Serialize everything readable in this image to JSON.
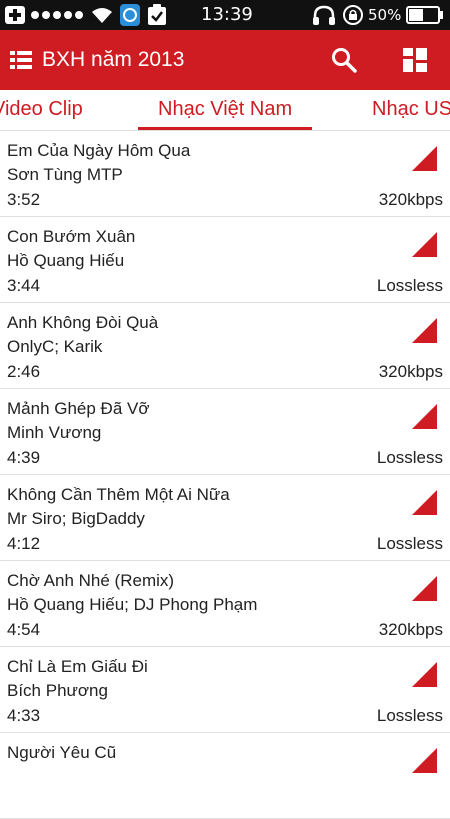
{
  "status_bar": {
    "time": "13:39",
    "battery": "50%"
  },
  "app_bar": {
    "title": "BXH năm 2013",
    "menu_icon": "list-menu-icon",
    "search_icon": "search-icon",
    "grid_icon": "grid-view-icon"
  },
  "tabs": [
    {
      "label": "Video Clip"
    },
    {
      "label": "Nhạc Việt Nam"
    },
    {
      "label": "Nhạc US"
    }
  ],
  "songs": [
    {
      "title": "Em Của Ngày Hôm Qua",
      "artist": "Sơn Tùng MTP",
      "duration": "3:52",
      "quality": "320kbps"
    },
    {
      "title": "Con Bướm Xuân",
      "artist": "Hồ Quang Hiếu",
      "duration": "3:44",
      "quality": "Lossless"
    },
    {
      "title": "Anh Không Đòi Quà",
      "artist": "OnlyC; Karik",
      "duration": "2:46",
      "quality": "320kbps"
    },
    {
      "title": "Mảnh Ghép Đã Vỡ",
      "artist": "Minh Vương",
      "duration": "4:39",
      "quality": "Lossless"
    },
    {
      "title": "Không Cần Thêm Một Ai Nữa",
      "artist": "Mr Siro; BigDaddy",
      "duration": "4:12",
      "quality": "Lossless"
    },
    {
      "title": "Chờ Anh Nhé (Remix)",
      "artist": "Hồ Quang Hiếu; DJ Phong Phạm",
      "duration": "4:54",
      "quality": "320kbps"
    },
    {
      "title": "Chỉ Là Em Giấu Đi",
      "artist": "Bích Phương",
      "duration": "4:33",
      "quality": "Lossless"
    },
    {
      "title": "Người Yêu Cũ",
      "artist": "",
      "duration": "",
      "quality": ""
    }
  ],
  "colors": {
    "accent": "#cf1b22",
    "status_bar": "#111111"
  }
}
